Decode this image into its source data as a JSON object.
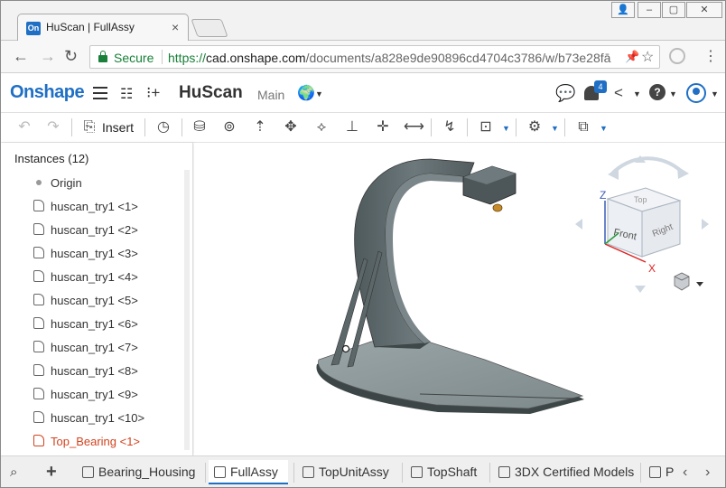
{
  "browser": {
    "tab_title": "HuScan | FullAssy",
    "favicon_text": "On",
    "secure_label": "Secure",
    "url_scheme": "https://",
    "url_host": "cad.onshape.com",
    "url_path": "/documents/a828e9de90896cd4704c3786/w/b73e28fā"
  },
  "app": {
    "logo": "Onshape",
    "document_name": "HuScan",
    "workspace": "Main",
    "notification_count": "4"
  },
  "toolbar": {
    "insert_label": "Insert"
  },
  "instances": {
    "header": "Instances (12)",
    "items": [
      {
        "label": "Origin",
        "kind": "origin"
      },
      {
        "label": "huscan_try1 <1>",
        "kind": "part"
      },
      {
        "label": "huscan_try1 <2>",
        "kind": "part"
      },
      {
        "label": "huscan_try1 <3>",
        "kind": "part"
      },
      {
        "label": "huscan_try1 <4>",
        "kind": "part"
      },
      {
        "label": "huscan_try1 <5>",
        "kind": "part"
      },
      {
        "label": "huscan_try1 <6>",
        "kind": "part"
      },
      {
        "label": "huscan_try1 <7>",
        "kind": "part"
      },
      {
        "label": "huscan_try1 <8>",
        "kind": "part"
      },
      {
        "label": "huscan_try1 <9>",
        "kind": "part"
      },
      {
        "label": "huscan_try1 <10>",
        "kind": "part"
      },
      {
        "label": "Top_Bearing <1>",
        "kind": "error"
      }
    ]
  },
  "viewcube": {
    "top": "Top",
    "front": "Front",
    "right": "Right",
    "axis_x": "X",
    "axis_z": "Z"
  },
  "bottom_tabs": [
    {
      "label": "Bearing_Housing"
    },
    {
      "label": "FullAssy"
    },
    {
      "label": "TopUnitAssy"
    },
    {
      "label": "TopShaft"
    },
    {
      "label": "3DX Certified Models"
    },
    {
      "label": "P"
    }
  ],
  "colors": {
    "brand_blue": "#1f6fc5",
    "secure_green": "#188038",
    "error_orange": "#d2431f",
    "model_gray": "#5f6b6e"
  }
}
